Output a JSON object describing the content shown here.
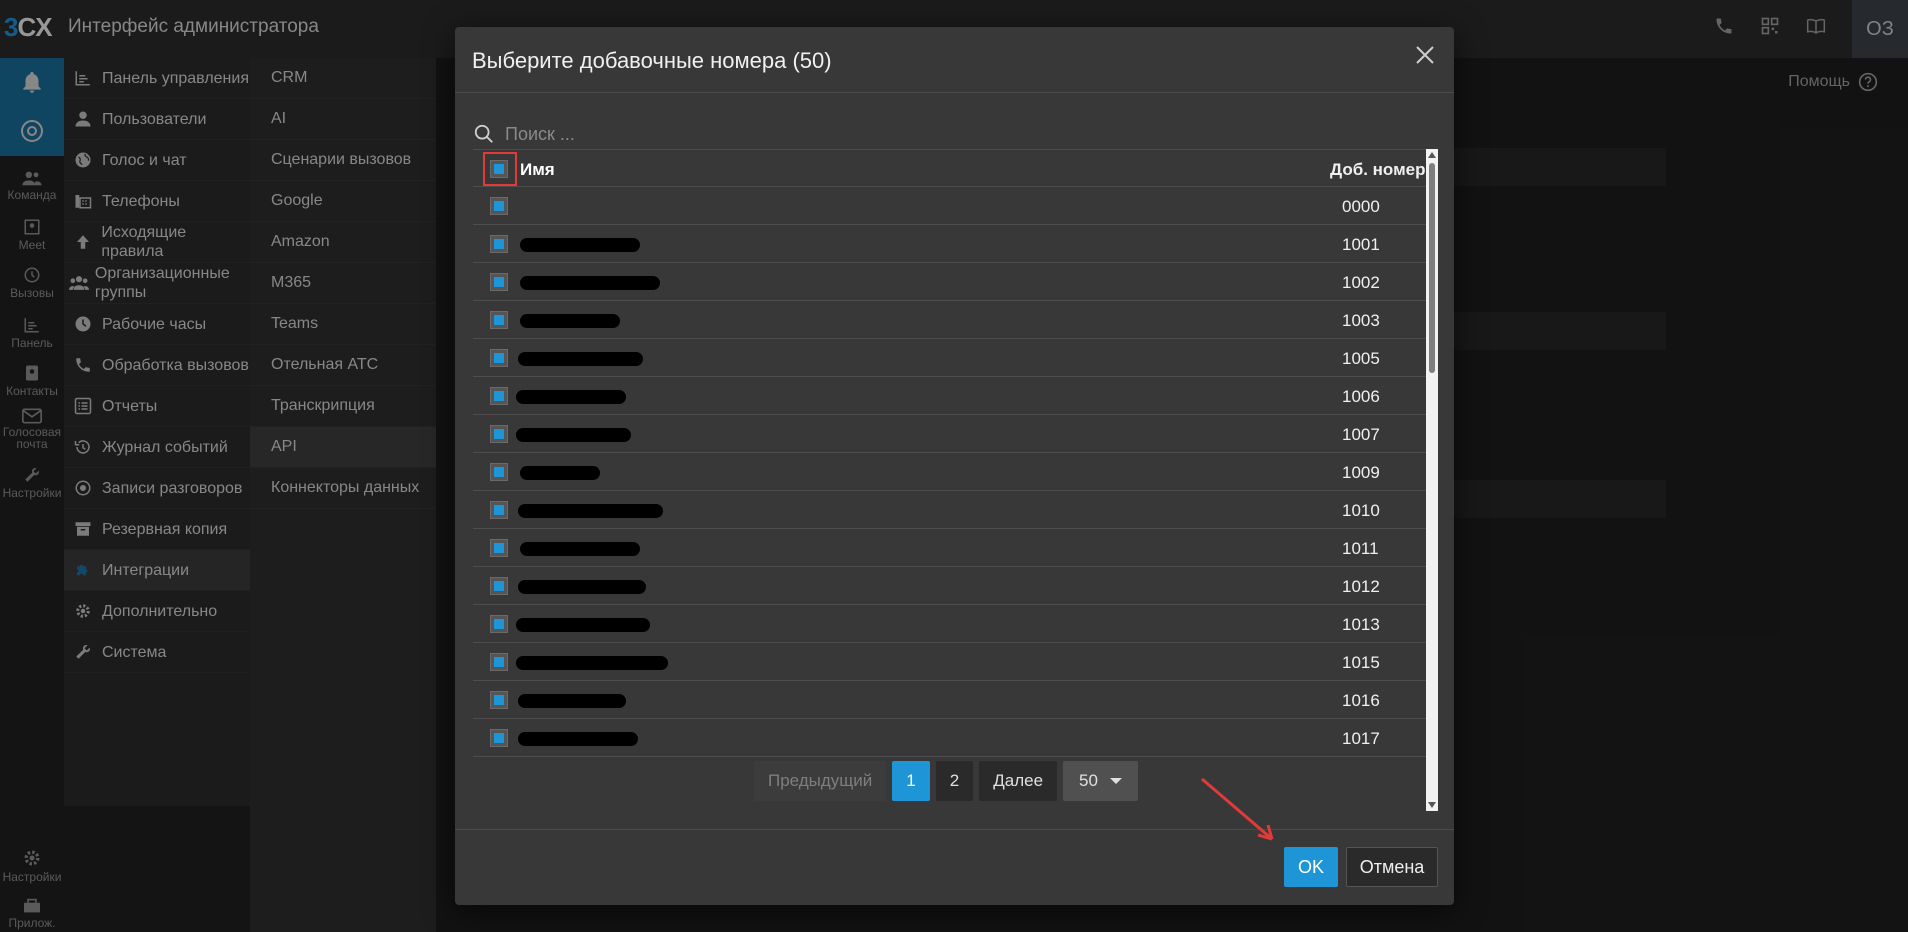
{
  "topbar": {
    "logo_prefix": "3",
    "logo_rest": "CX",
    "title": "Интерфейс администратора",
    "avatar": "ОЗ"
  },
  "rail": {
    "items": [
      {
        "label": "Команда",
        "icon": "team-icon"
      },
      {
        "label": "Meet",
        "icon": "meet-icon"
      },
      {
        "label": "Вызовы",
        "icon": "history-icon"
      },
      {
        "label": "Панель",
        "icon": "chart-icon"
      },
      {
        "label": "Контакты",
        "icon": "contacts-icon"
      },
      {
        "label": "Голосовая почта",
        "icon": "mail-icon"
      },
      {
        "label": "Настройки",
        "icon": "wrench-icon"
      }
    ],
    "bottom": [
      {
        "label": "Настройки",
        "icon": "gear-icon"
      },
      {
        "label": "Прилож.",
        "icon": "apps-icon"
      }
    ]
  },
  "nav": {
    "items": [
      {
        "label": "Панель управления",
        "icon": "dashboard-icon"
      },
      {
        "label": "Пользователи",
        "icon": "user-icon"
      },
      {
        "label": "Голос и чат",
        "icon": "globe-icon"
      },
      {
        "label": "Телефоны",
        "icon": "fax-icon"
      },
      {
        "label": "Исходящие правила",
        "icon": "arrow-up-icon"
      },
      {
        "label": "Организационные группы",
        "icon": "group-icon"
      },
      {
        "label": "Рабочие часы",
        "icon": "clock-icon"
      },
      {
        "label": "Обработка вызовов",
        "icon": "phone-icon"
      },
      {
        "label": "Отчеты",
        "icon": "list-icon"
      },
      {
        "label": "Журнал событий",
        "icon": "history-icon"
      },
      {
        "label": "Записи разговоров",
        "icon": "record-icon"
      },
      {
        "label": "Резервная копия",
        "icon": "archive-icon"
      },
      {
        "label": "Интеграции",
        "icon": "puzzle-icon"
      },
      {
        "label": "Дополнительно",
        "icon": "gear-icon"
      },
      {
        "label": "Система",
        "icon": "wrench-icon"
      }
    ]
  },
  "subnav": {
    "items": [
      "CRM",
      "AI",
      "Сценарии вызовов",
      "Google",
      "Amazon",
      "M365",
      "Teams",
      "Отельная АТС",
      "Транскрипция",
      "API",
      "Коннекторы данных"
    ]
  },
  "content": {
    "help": "Помощь"
  },
  "modal": {
    "title": "Выберите добавочные номера (50)",
    "search_placeholder": "Поиск ...",
    "col_name": "Имя",
    "col_ext": "Доб. номер",
    "rows": [
      {
        "ext": "0000"
      },
      {
        "ext": "1001"
      },
      {
        "ext": "1002"
      },
      {
        "ext": "1003"
      },
      {
        "ext": "1005"
      },
      {
        "ext": "1006"
      },
      {
        "ext": "1007"
      },
      {
        "ext": "1009"
      },
      {
        "ext": "1010"
      },
      {
        "ext": "1011"
      },
      {
        "ext": "1012"
      },
      {
        "ext": "1013"
      },
      {
        "ext": "1015"
      },
      {
        "ext": "1016"
      },
      {
        "ext": "1017"
      }
    ],
    "pager": {
      "prev": "Предыдущий",
      "pages": [
        "1",
        "2"
      ],
      "current": "1",
      "next": "Далее",
      "page_size": "50"
    },
    "ok": "OK",
    "cancel": "Отмена"
  },
  "colors": {
    "accent": "#1e95d6",
    "highlight": "#e03a3a"
  }
}
